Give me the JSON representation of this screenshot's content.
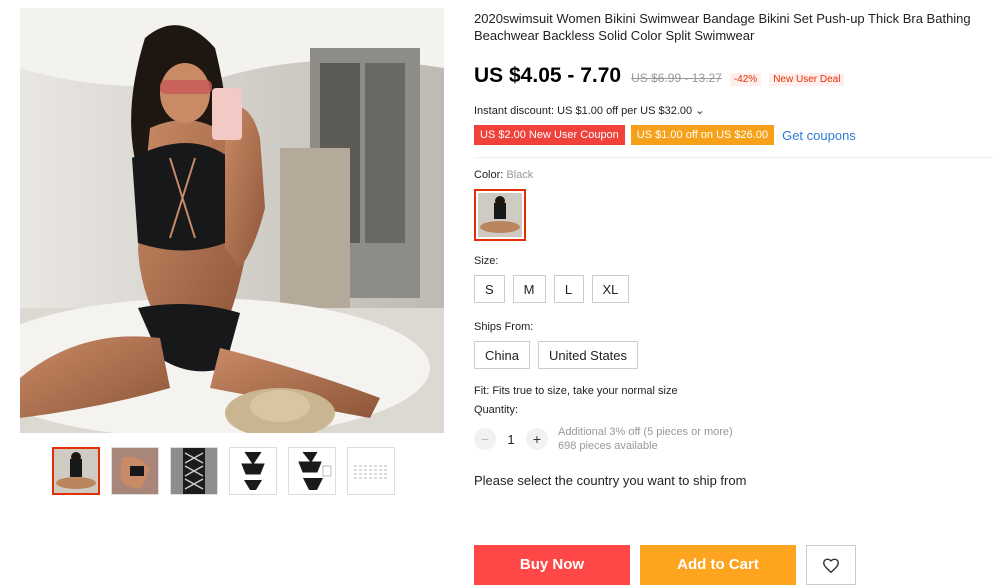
{
  "product": {
    "title": "2020swimsuit Women Bikini Swimwear Bandage Bikini Set Push-up Thick Bra Bathing Beachwear Backless Solid Color Split Swimwear",
    "price": "US $4.05 - 7.70",
    "original_price": "US $6.99 - 13.27",
    "discount_pct": "-42%",
    "deal_badge": "New User Deal",
    "instant_discount": "Instant discount: US $1.00 off per US $32.00 ⌄",
    "coupons": [
      "US $2.00 New User Coupon",
      "US $1.00 off on US $26.00"
    ],
    "get_coupons": "Get coupons",
    "color_label": "Color:",
    "color_value": "Black",
    "size_label": "Size:",
    "sizes": [
      "S",
      "M",
      "L",
      "XL"
    ],
    "ships_label": "Ships From:",
    "ships": [
      "China",
      "United States"
    ],
    "fit": "Fit: Fits true to size, take your normal size",
    "quantity_label": "Quantity:",
    "quantity": "1",
    "minus": "−",
    "plus": "+",
    "additional": "Additional 3% off (5 pieces or more)",
    "available": "698 pieces available",
    "ship_prompt": "Please select the country you want to ship from",
    "buy_now": "Buy Now",
    "add_to_cart": "Add to Cart",
    "wishlist_icon": "heart-icon"
  },
  "colors": {
    "accent_red": "#e62e04",
    "buy_now": "#ff4747",
    "add_to_cart": "#ffa41f"
  }
}
